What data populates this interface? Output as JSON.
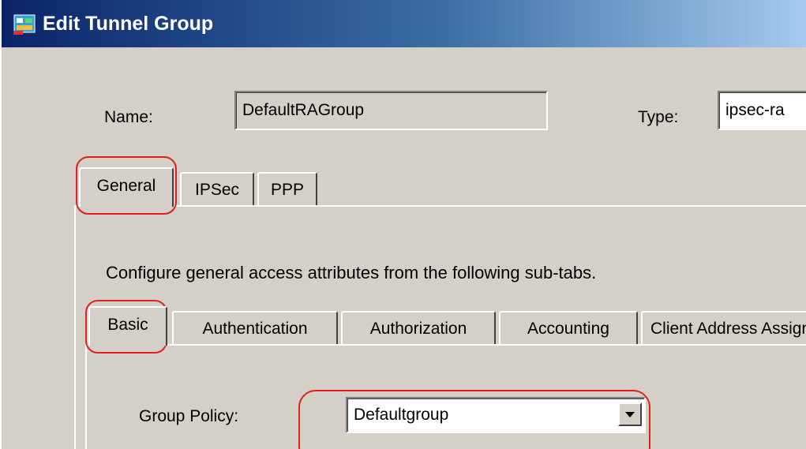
{
  "window": {
    "title": "Edit Tunnel Group",
    "title_icon": "asdm-app-icon"
  },
  "form": {
    "name_label": "Name:",
    "name_value": "DefaultRAGroup",
    "type_label": "Type:",
    "type_value": "ipsec-ra"
  },
  "tabs": [
    {
      "label": "General",
      "selected": true
    },
    {
      "label": "IPSec",
      "selected": false
    },
    {
      "label": "PPP",
      "selected": false
    }
  ],
  "general": {
    "description": "Configure general access attributes from the following sub-tabs."
  },
  "subtabs": [
    {
      "label": "Basic",
      "selected": true
    },
    {
      "label": "Authentication",
      "selected": false
    },
    {
      "label": "Authorization",
      "selected": false
    },
    {
      "label": "Accounting",
      "selected": false
    },
    {
      "label": "Client Address Assignment",
      "selected": false
    }
  ],
  "basic": {
    "group_policy_label": "Group Policy:",
    "group_policy_value": "Defaultgroup"
  },
  "colors": {
    "highlight": "#e0201a",
    "dialog_bg": "#d4d0c8",
    "titlebar_start": "#0a246a",
    "titlebar_end": "#a6caf0"
  }
}
